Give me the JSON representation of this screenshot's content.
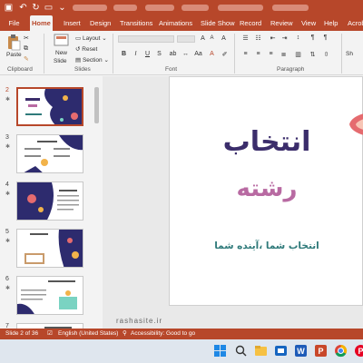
{
  "app": {
    "file_tab": "File",
    "tabs": [
      "Home",
      "Insert",
      "Design",
      "Transitions",
      "Animations",
      "Slide Show",
      "Record",
      "Review",
      "View",
      "Help",
      "Acrobat"
    ],
    "active_tab": "Home"
  },
  "ribbon": {
    "clipboard": {
      "paste": "Paste",
      "label": "Clipboard"
    },
    "slides": {
      "new_slide": "New",
      "new_slide2": "Slide",
      "layout": "Layout",
      "reset": "Reset",
      "section": "Section",
      "label": "Slides"
    },
    "font": {
      "label": "Font",
      "buttons": [
        "B",
        "I",
        "U",
        "S"
      ]
    },
    "paragraph": {
      "label": "Paragraph"
    },
    "shapes": "Sh"
  },
  "thumbnails": [
    {
      "num": "2",
      "selected": true
    },
    {
      "num": "3",
      "selected": false
    },
    {
      "num": "4",
      "selected": false
    },
    {
      "num": "5",
      "selected": false
    },
    {
      "num": "6",
      "selected": false
    },
    {
      "num": "7",
      "selected": false
    }
  ],
  "slide": {
    "title": "انتخاب",
    "subtitle": "رشته",
    "tagline": "انتخاب شما ،آینده شما",
    "title_color": "#3b2d6b",
    "subtitle_color": "#b86aa2",
    "tagline_color": "#2f7a7a"
  },
  "watermark": "rashasite.ir",
  "status": {
    "slide_of": "Slide 2 of 36",
    "language": "English (United States)",
    "accessibility": "Accessibility: Good to go"
  },
  "colors": {
    "accent": "#b7472a"
  },
  "taskbar": {
    "icons": [
      "windows-icon",
      "search-icon",
      "task-view-icon",
      "file-explorer-icon",
      "word-icon",
      "powerpoint-icon",
      "chrome-icon",
      "pinterest-icon",
      "app-icon"
    ]
  }
}
